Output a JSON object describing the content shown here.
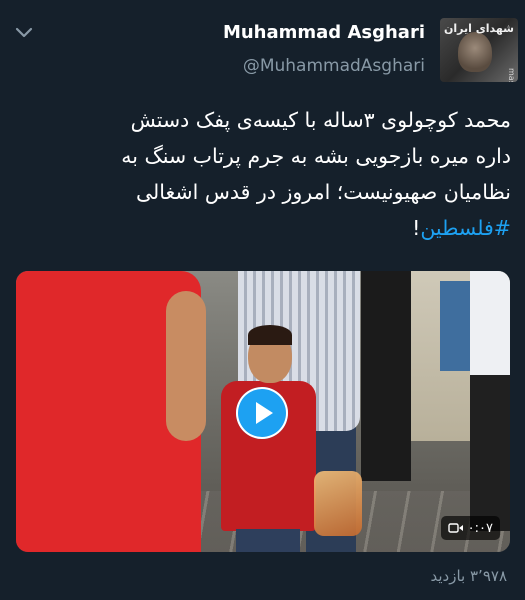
{
  "author": {
    "name": "Muhammad Asghari",
    "handle": "@MuhammadAsghari"
  },
  "avatar": {
    "logo_text": "شهدای ایران",
    "watermark": "mashreghnews"
  },
  "tweet": {
    "lines": [
      "محمد کوچولوی ۳ساله با کیسه‌ی پفک دستش",
      "داره میره بازجویی بشه به جرم پرتاب سنگ به",
      "نظامیان صهیونیست؛ امروز در قدس اشغالی"
    ],
    "hashtag": "#فلسطین",
    "hashtag_suffix": "!"
  },
  "video": {
    "duration": "۰:۰۷",
    "play_label": "play"
  },
  "stats": {
    "views": "۳٬۹۷۸ بازدید"
  },
  "colors": {
    "background": "#15202b",
    "accent": "#1da1f2",
    "muted": "#8899a6"
  },
  "icons": {
    "menu": "chevron-down-icon",
    "play": "play-icon",
    "video": "video-camera-icon"
  }
}
